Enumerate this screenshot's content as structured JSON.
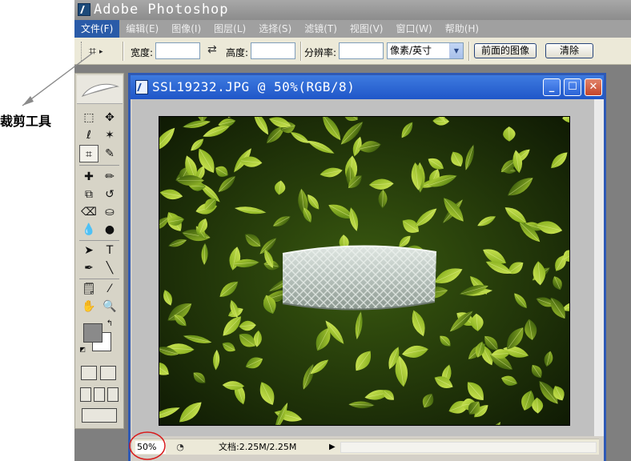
{
  "app": {
    "title": "Adobe Photoshop"
  },
  "menubar": {
    "items": [
      {
        "label": "文件(F)",
        "active": true
      },
      {
        "label": "编辑(E)"
      },
      {
        "label": "图像(I)"
      },
      {
        "label": "图层(L)"
      },
      {
        "label": "选择(S)"
      },
      {
        "label": "滤镜(T)"
      },
      {
        "label": "视图(V)"
      },
      {
        "label": "窗口(W)"
      },
      {
        "label": "帮助(H)"
      }
    ]
  },
  "options": {
    "width_label": "宽度:",
    "width_value": "",
    "height_label": "高度:",
    "height_value": "",
    "resolution_label": "分辨率:",
    "resolution_value": "",
    "unit_select": "像素/英寸",
    "front_image_button": "前面的图像",
    "clear_button": "清除"
  },
  "document": {
    "title": "SSL19232.JPG @ 50%(RGB/8)",
    "zoom": "50%",
    "doc_info": "文档:2.25M/2.25M"
  },
  "annotation": {
    "label": "裁剪工具",
    "color": "#d81b1b"
  },
  "colors": {
    "foreground": "#8a8a8a",
    "background": "#ffffff",
    "titlebar_active": "#2a5ba8"
  },
  "icons": {
    "close": "✕",
    "maximize": "☐",
    "minimize": "_",
    "crop": "⌗",
    "move": "✥",
    "marquee": "⬚",
    "lasso": "ℓ",
    "wand": "✶",
    "slice": "✎",
    "heal": "✚",
    "brush": "✏",
    "stamp": "⧉",
    "history": "↺",
    "eraser": "⌫",
    "bucket": "⛀",
    "blur": "💧",
    "dodge": "●",
    "path": "➤",
    "text": "T",
    "pen": "✒",
    "line": "╲",
    "notes": "🗒",
    "eyedropper": "⁄",
    "hand": "✋",
    "zoom": "🔍"
  }
}
